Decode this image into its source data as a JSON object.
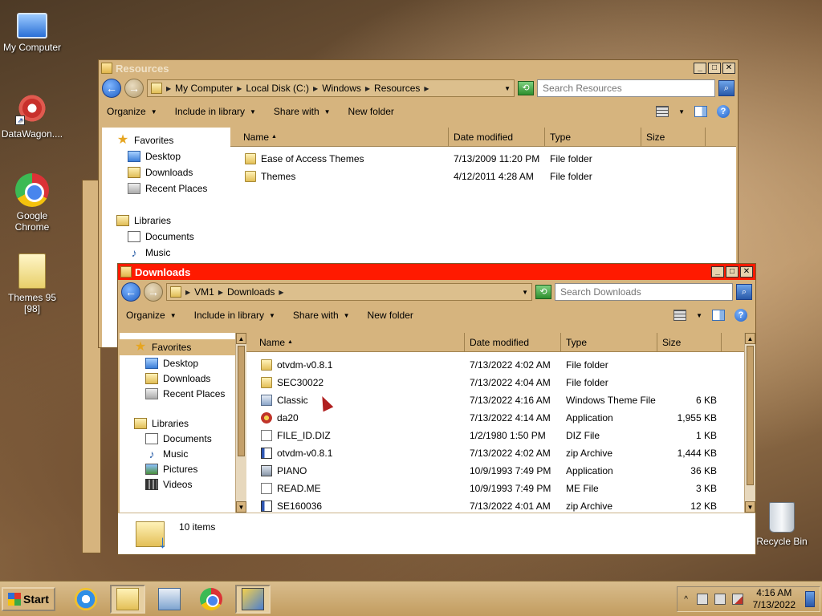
{
  "desktop": {
    "icons": [
      {
        "label": "My Computer",
        "icon": "computer-icon"
      },
      {
        "label": "DataWagon....",
        "icon": "datawagon-icon"
      },
      {
        "label": "Google Chrome",
        "icon": "chrome-icon"
      },
      {
        "label": "Themes 95 [98]",
        "icon": "folder-icon"
      },
      {
        "label": "Recycle Bin",
        "icon": "recycle-bin-icon"
      }
    ]
  },
  "resources_window": {
    "title": "Resources",
    "breadcrumb": [
      "My Computer",
      "Local Disk (C:)",
      "Windows",
      "Resources"
    ],
    "search_placeholder": "Search Resources",
    "toolbar": {
      "organize": "Organize",
      "include": "Include in library",
      "share": "Share with",
      "new_folder": "New folder"
    },
    "nav": {
      "favorites": "Favorites",
      "desktop": "Desktop",
      "downloads": "Downloads",
      "recent": "Recent Places",
      "libraries": "Libraries",
      "documents": "Documents",
      "music": "Music"
    },
    "columns": {
      "name": "Name",
      "date": "Date modified",
      "type": "Type",
      "size": "Size"
    },
    "files": [
      {
        "name": "Ease of Access Themes",
        "date": "7/13/2009 11:20 PM",
        "type": "File folder",
        "size": ""
      },
      {
        "name": "Themes",
        "date": "4/12/2011 4:28 AM",
        "type": "File folder",
        "size": ""
      }
    ]
  },
  "downloads_window": {
    "title": "Downloads",
    "breadcrumb": [
      "VM1",
      "Downloads"
    ],
    "search_placeholder": "Search Downloads",
    "toolbar": {
      "organize": "Organize",
      "include": "Include in library",
      "share": "Share with",
      "new_folder": "New folder"
    },
    "nav": {
      "favorites": "Favorites",
      "desktop": "Desktop",
      "downloads": "Downloads",
      "recent": "Recent Places",
      "libraries": "Libraries",
      "documents": "Documents",
      "music": "Music",
      "pictures": "Pictures",
      "videos": "Videos"
    },
    "columns": {
      "name": "Name",
      "date": "Date modified",
      "type": "Type",
      "size": "Size"
    },
    "files": [
      {
        "name": "otvdm-v0.8.1",
        "date": "7/13/2022 4:02 AM",
        "type": "File folder",
        "size": "",
        "icon": "folder"
      },
      {
        "name": "SEC30022",
        "date": "7/13/2022 4:04 AM",
        "type": "File folder",
        "size": "",
        "icon": "folder"
      },
      {
        "name": "Classic",
        "date": "7/13/2022 4:16 AM",
        "type": "Windows Theme File",
        "size": "6 KB",
        "icon": "theme"
      },
      {
        "name": "da20",
        "date": "7/13/2022 4:14 AM",
        "type": "Application",
        "size": "1,955 KB",
        "icon": "app"
      },
      {
        "name": "FILE_ID.DIZ",
        "date": "1/2/1980 1:50 PM",
        "type": "DIZ File",
        "size": "1 KB",
        "icon": "file"
      },
      {
        "name": "otvdm-v0.8.1",
        "date": "7/13/2022 4:02 AM",
        "type": "zip Archive",
        "size": "1,444 KB",
        "icon": "zip"
      },
      {
        "name": "PIANO",
        "date": "10/9/1993 7:49 PM",
        "type": "Application",
        "size": "36 KB",
        "icon": "exe"
      },
      {
        "name": "READ.ME",
        "date": "10/9/1993 7:49 PM",
        "type": "ME File",
        "size": "3 KB",
        "icon": "file"
      },
      {
        "name": "SE160036",
        "date": "7/13/2022 4:01 AM",
        "type": "zip Archive",
        "size": "12 KB",
        "icon": "zip"
      }
    ],
    "status": "10 items"
  },
  "taskbar": {
    "start_label": "Start",
    "clock_time": "4:16 AM",
    "clock_date": "7/13/2022"
  },
  "colors": {
    "active_title": "#ff1a00",
    "inactive_title": "#d6b47e",
    "window_face": "#d6b47e"
  }
}
